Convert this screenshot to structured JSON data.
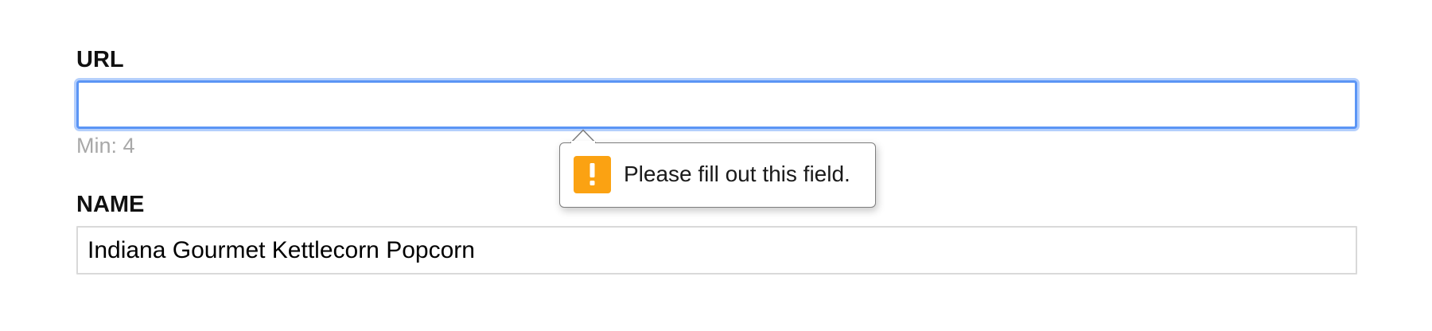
{
  "form": {
    "url_field": {
      "label": "URL",
      "value": "",
      "hint": "Min: 4"
    },
    "name_field": {
      "label": "NAME",
      "value": "Indiana Gourmet Kettlecorn Popcorn"
    }
  },
  "validation_tooltip": {
    "message": "Please fill out this field.",
    "icon": "warning-icon"
  },
  "colors": {
    "focus_ring": "#5b95f5",
    "warning": "#fba212",
    "hint_text": "#a8a8a8"
  }
}
